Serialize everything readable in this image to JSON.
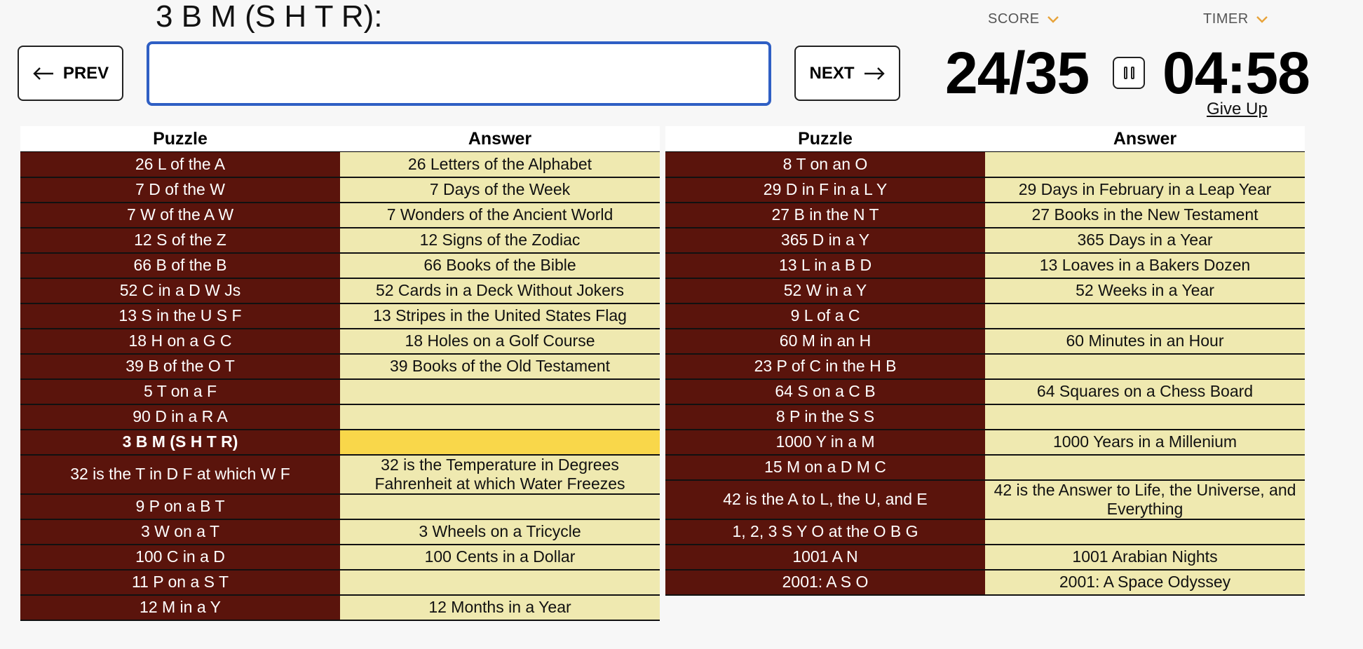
{
  "prompt": {
    "current_puzzle": "3 B M (S H T R):"
  },
  "input": {
    "value": "",
    "placeholder": ""
  },
  "nav": {
    "prev_label": "PREV",
    "next_label": "NEXT"
  },
  "score": {
    "label": "SCORE",
    "value": "24/35"
  },
  "timer": {
    "label": "TIMER",
    "value": "04:58",
    "give_up_label": "Give Up"
  },
  "table_headers": {
    "puzzle": "Puzzle",
    "answer": "Answer"
  },
  "colors": {
    "puzzle_bg": "#5a140c",
    "answer_bg": "#efe9b0",
    "current_bg": "#f9d74a",
    "accent": "#e8a33a",
    "input_border": "#2f5fc4"
  },
  "icons": {
    "prev": "arrow-left-icon",
    "next": "arrow-right-icon",
    "pause": "pause-icon",
    "dropdown": "chevron-down-icon"
  },
  "left_table": [
    {
      "puzzle": "26 L of the A",
      "answer": "26 Letters of the Alphabet"
    },
    {
      "puzzle": "7 D of the W",
      "answer": "7 Days of the Week"
    },
    {
      "puzzle": "7 W of the A W",
      "answer": "7 Wonders of the Ancient World"
    },
    {
      "puzzle": "12 S of the Z",
      "answer": "12 Signs of the Zodiac"
    },
    {
      "puzzle": "66 B of the B",
      "answer": "66 Books of the Bible"
    },
    {
      "puzzle": "52 C in a D W Js",
      "answer": "52 Cards in a Deck Without Jokers"
    },
    {
      "puzzle": "13 S in the U S F",
      "answer": "13 Stripes in the United States Flag"
    },
    {
      "puzzle": "18 H on a G C",
      "answer": "18 Holes on a Golf Course"
    },
    {
      "puzzle": "39 B of the O T",
      "answer": "39 Books of the Old Testament"
    },
    {
      "puzzle": "5 T on a F",
      "answer": ""
    },
    {
      "puzzle": "90 D in a R A",
      "answer": ""
    },
    {
      "puzzle": "3 B M (S H T R)",
      "answer": "",
      "current": true
    },
    {
      "puzzle": "32 is the T in D F at which W F",
      "answer": "32 is the Temperature in Degrees Fahrenheit at which Water Freezes"
    },
    {
      "puzzle": "9 P on a B T",
      "answer": ""
    },
    {
      "puzzle": "3 W on a T",
      "answer": "3 Wheels on a Tricycle"
    },
    {
      "puzzle": "100 C in a D",
      "answer": "100 Cents in a Dollar"
    },
    {
      "puzzle": "11 P on a S T",
      "answer": ""
    },
    {
      "puzzle": "12 M in a Y",
      "answer": "12 Months in a Year"
    }
  ],
  "right_table": [
    {
      "puzzle": "8 T on an O",
      "answer": ""
    },
    {
      "puzzle": "29 D in F in a L Y",
      "answer": "29 Days in February in a Leap Year"
    },
    {
      "puzzle": "27 B in the N T",
      "answer": "27 Books in the New Testament"
    },
    {
      "puzzle": "365 D in a Y",
      "answer": "365 Days in a Year"
    },
    {
      "puzzle": "13 L in a B D",
      "answer": "13 Loaves in a Bakers Dozen"
    },
    {
      "puzzle": "52 W in a Y",
      "answer": "52 Weeks in a Year"
    },
    {
      "puzzle": "9 L of a C",
      "answer": ""
    },
    {
      "puzzle": "60 M in an H",
      "answer": "60 Minutes in an Hour"
    },
    {
      "puzzle": "23 P of C in the H B",
      "answer": ""
    },
    {
      "puzzle": "64 S on a C B",
      "answer": "64 Squares on a Chess Board"
    },
    {
      "puzzle": "8 P in the S S",
      "answer": ""
    },
    {
      "puzzle": "1000 Y in a M",
      "answer": "1000 Years in a Millenium"
    },
    {
      "puzzle": "15 M on a D M C",
      "answer": ""
    },
    {
      "puzzle": "42 is the A to L, the U, and E",
      "answer": "42 is the Answer to Life, the Universe, and Everything"
    },
    {
      "puzzle": "1, 2, 3 S Y O at the O B G",
      "answer": ""
    },
    {
      "puzzle": "1001 A N",
      "answer": "1001 Arabian Nights"
    },
    {
      "puzzle": "2001: A S O",
      "answer": "2001: A Space Odyssey"
    }
  ]
}
